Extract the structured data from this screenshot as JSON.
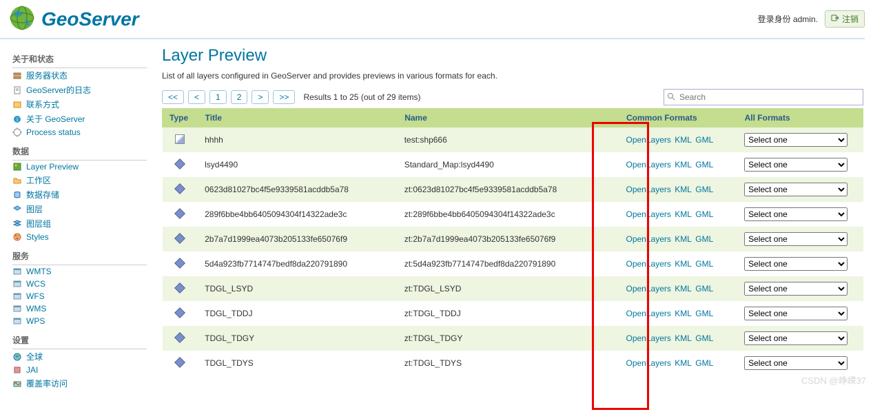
{
  "header": {
    "brand": "GeoServer",
    "login_status": "登录身份 admin.",
    "logout_label": "注销"
  },
  "sidebar": {
    "sections": [
      {
        "title": "关于和状态",
        "items": [
          {
            "label": "服务器状态",
            "icon": "server"
          },
          {
            "label": "GeoServer的日志",
            "icon": "log"
          },
          {
            "label": "联系方式",
            "icon": "contact"
          },
          {
            "label": "关于 GeoServer",
            "icon": "about"
          },
          {
            "label": "Process status",
            "icon": "process"
          }
        ]
      },
      {
        "title": "数据",
        "items": [
          {
            "label": "Layer Preview",
            "icon": "preview"
          },
          {
            "label": "工作区",
            "icon": "workspace"
          },
          {
            "label": "数据存储",
            "icon": "store"
          },
          {
            "label": "图层",
            "icon": "layer"
          },
          {
            "label": "图层组",
            "icon": "layergroup"
          },
          {
            "label": "Styles",
            "icon": "style"
          }
        ]
      },
      {
        "title": "服务",
        "items": [
          {
            "label": "WMTS",
            "icon": "svc"
          },
          {
            "label": "WCS",
            "icon": "svc"
          },
          {
            "label": "WFS",
            "icon": "svc"
          },
          {
            "label": "WMS",
            "icon": "svc"
          },
          {
            "label": "WPS",
            "icon": "svc"
          }
        ]
      },
      {
        "title": "设置",
        "items": [
          {
            "label": "全球",
            "icon": "global"
          },
          {
            "label": "JAI",
            "icon": "jai"
          },
          {
            "label": "覆盖率访问",
            "icon": "coverage"
          }
        ]
      }
    ]
  },
  "page": {
    "title": "Layer Preview",
    "description": "List of all layers configured in GeoServer and provides previews in various formats for each.",
    "pager": {
      "first": "<<",
      "prev": "<",
      "p1": "1",
      "p2": "2",
      "next": ">",
      "last": ">>",
      "info": "Results 1 to 25 (out of 29 items)"
    },
    "search_placeholder": "Search",
    "columns": {
      "type": "Type",
      "title": "Title",
      "name": "Name",
      "common": "Common Formats",
      "all": "All Formats"
    },
    "fmt": {
      "ol": "OpenLayers",
      "kml": "KML",
      "gml": "GML"
    },
    "select_default": "Select one",
    "rows": [
      {
        "type": "other",
        "title": "hhhh",
        "name": "test:shp666"
      },
      {
        "type": "poly",
        "title": "lsyd4490",
        "name": "Standard_Map:lsyd4490"
      },
      {
        "type": "poly",
        "title": "0623d81027bc4f5e9339581acddb5a78",
        "name": "zt:0623d81027bc4f5e9339581acddb5a78"
      },
      {
        "type": "poly",
        "title": "289f6bbe4bb6405094304f14322ade3c",
        "name": "zt:289f6bbe4bb6405094304f14322ade3c"
      },
      {
        "type": "poly",
        "title": "2b7a7d1999ea4073b205133fe65076f9",
        "name": "zt:2b7a7d1999ea4073b205133fe65076f9"
      },
      {
        "type": "poly",
        "title": "5d4a923fb7714747bedf8da220791890",
        "name": "zt:5d4a923fb7714747bedf8da220791890"
      },
      {
        "type": "poly",
        "title": "TDGL_LSYD",
        "name": "zt:TDGL_LSYD"
      },
      {
        "type": "poly",
        "title": "TDGL_TDDJ",
        "name": "zt:TDGL_TDDJ"
      },
      {
        "type": "poly",
        "title": "TDGL_TDGY",
        "name": "zt:TDGL_TDGY"
      },
      {
        "type": "poly",
        "title": "TDGL_TDYS",
        "name": "zt:TDGL_TDYS"
      }
    ]
  },
  "watermark": "CSDN @峥嵘37"
}
